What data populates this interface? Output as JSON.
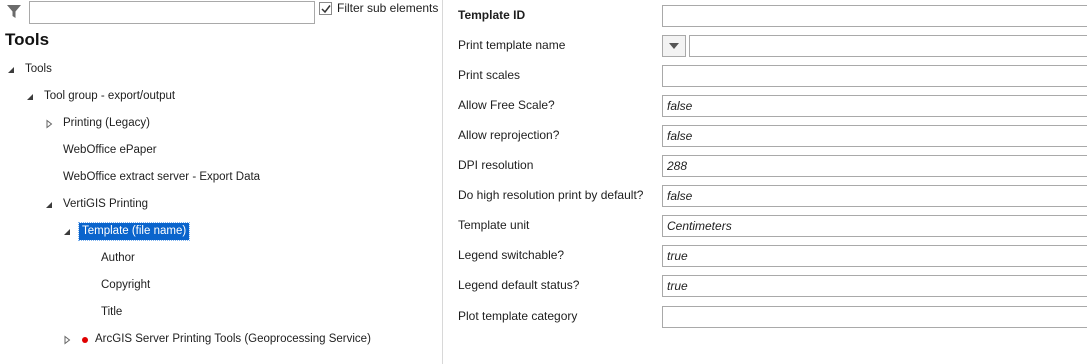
{
  "filter": {
    "placeholder": "",
    "value": "",
    "checkbox_label": "Filter sub elements",
    "checkbox_checked": true
  },
  "tree": {
    "title": "Tools",
    "nodes": [
      {
        "label": "Tools",
        "expanded": true,
        "level": 0
      },
      {
        "label": "Tool group - export/output",
        "expanded": true,
        "level": 1
      },
      {
        "label": "Printing (Legacy)",
        "expanded": false,
        "level": 2
      },
      {
        "label": "WebOffice ePaper",
        "level": 2
      },
      {
        "label": "WebOffice extract server - Export Data",
        "level": 2
      },
      {
        "label": "VertiGIS Printing",
        "expanded": true,
        "level": 2
      },
      {
        "label": "Template (file name)",
        "expanded": true,
        "level": 3,
        "selected": true
      },
      {
        "label": "Author",
        "level": 4
      },
      {
        "label": "Copyright",
        "level": 4
      },
      {
        "label": "Title",
        "level": 4
      },
      {
        "label": "ArcGIS Server Printing Tools (Geoprocessing Service)",
        "expanded": false,
        "level": 3,
        "status": "error"
      }
    ]
  },
  "properties": [
    {
      "label": "Template ID",
      "value": ""
    },
    {
      "label": "Print template name",
      "value": ""
    },
    {
      "label": "Print scales",
      "value": ""
    },
    {
      "label": "Allow Free Scale?",
      "value": "false"
    },
    {
      "label": "Allow reprojection?",
      "value": "false"
    },
    {
      "label": "DPI resolution",
      "value": "288"
    },
    {
      "label": "Do high resolution print by default?",
      "value": "false"
    },
    {
      "label": "Template unit",
      "value": "Centimeters"
    },
    {
      "label": "Legend switchable?",
      "value": "true"
    },
    {
      "label": "Legend default status?",
      "value": "true"
    },
    {
      "label": "Plot template category",
      "value": ""
    }
  ],
  "colors": {
    "selection": "#0a64cc",
    "error_dot": "#e00000"
  }
}
